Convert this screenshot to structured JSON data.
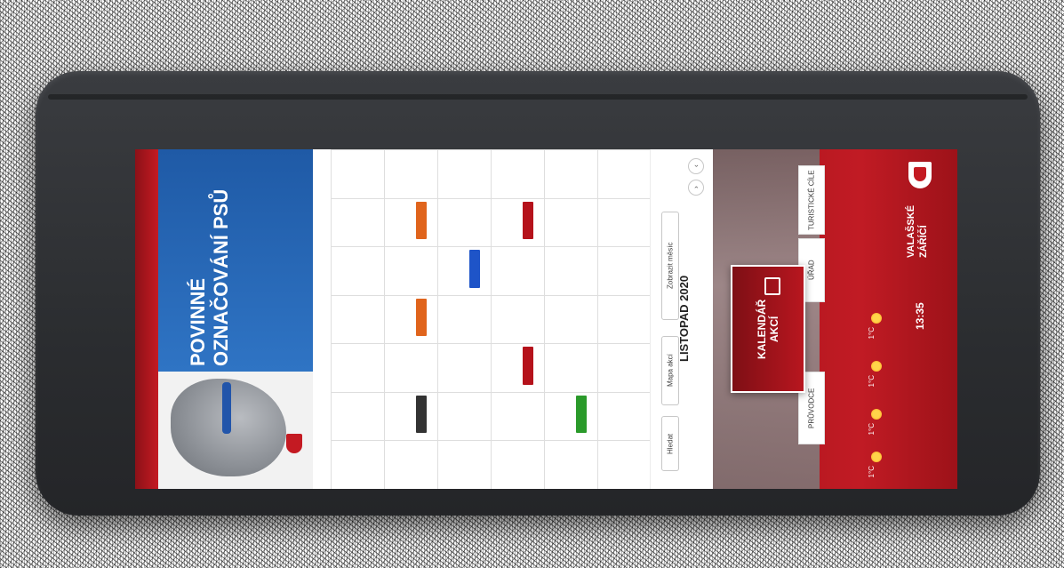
{
  "poster": {
    "title": "POVINNÉ OZNAČOVÁNÍ PSŮ"
  },
  "calendar": {
    "month": "LISTOPAD 2020",
    "buttons": [
      {
        "label": "Hledat"
      },
      {
        "label": "Mapa akcí"
      },
      {
        "label": "Zobrazit měsíc"
      }
    ],
    "events": [
      {
        "col": 1,
        "row": 1,
        "color": "#e0641c"
      },
      {
        "col": 2,
        "row": 2,
        "color": "#1e54c8"
      },
      {
        "col": 1,
        "row": 3,
        "color": "#e0641c"
      },
      {
        "col": 3,
        "row": 1,
        "color": "#b5121b"
      },
      {
        "col": 3,
        "row": 4,
        "color": "#b5121b"
      },
      {
        "col": 4,
        "row": 5,
        "color": "#2a9a2a"
      },
      {
        "col": 1,
        "row": 5,
        "color": "#333333"
      }
    ]
  },
  "sidebar": {
    "brand_name": "VALAŠSKÉ ZÁŘÍČÍ",
    "time": "13:35",
    "tiles": [
      {
        "label": "TURISTICKÉ CÍLE"
      },
      {
        "label": "ÚŘAD"
      },
      {
        "label": "PRŮVODCE"
      }
    ],
    "kalendar": "KALENDÁŘ AKCÍ",
    "weather": [
      {
        "temp": "1°C"
      },
      {
        "temp": "1°C"
      },
      {
        "temp": "1°C"
      },
      {
        "temp": "1°C"
      }
    ]
  },
  "colors": {
    "device": "#2b2d30",
    "brand_red": "#c11b24",
    "poster_blue": "#2f74c4"
  }
}
